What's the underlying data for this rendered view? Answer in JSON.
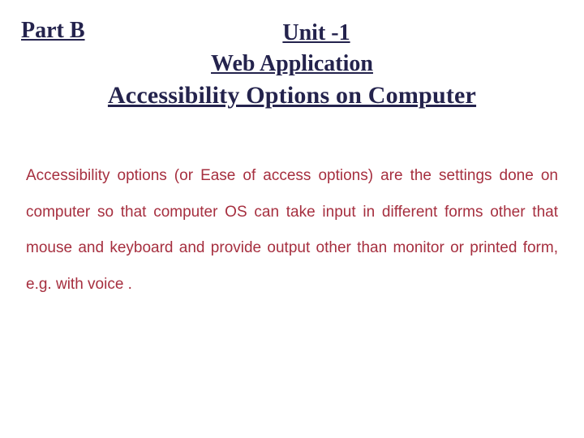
{
  "header": {
    "part_label": "Part B",
    "title_line1": "Unit -1",
    "title_line2": "Web Application",
    "title_line3": "Accessibility Options on Computer"
  },
  "body": {
    "paragraph": "Accessibility options (or Ease of access options) are the settings done on computer so that computer OS can take input in different forms other that mouse and keyboard and provide output other than monitor or printed form, e.g. with voice ."
  }
}
